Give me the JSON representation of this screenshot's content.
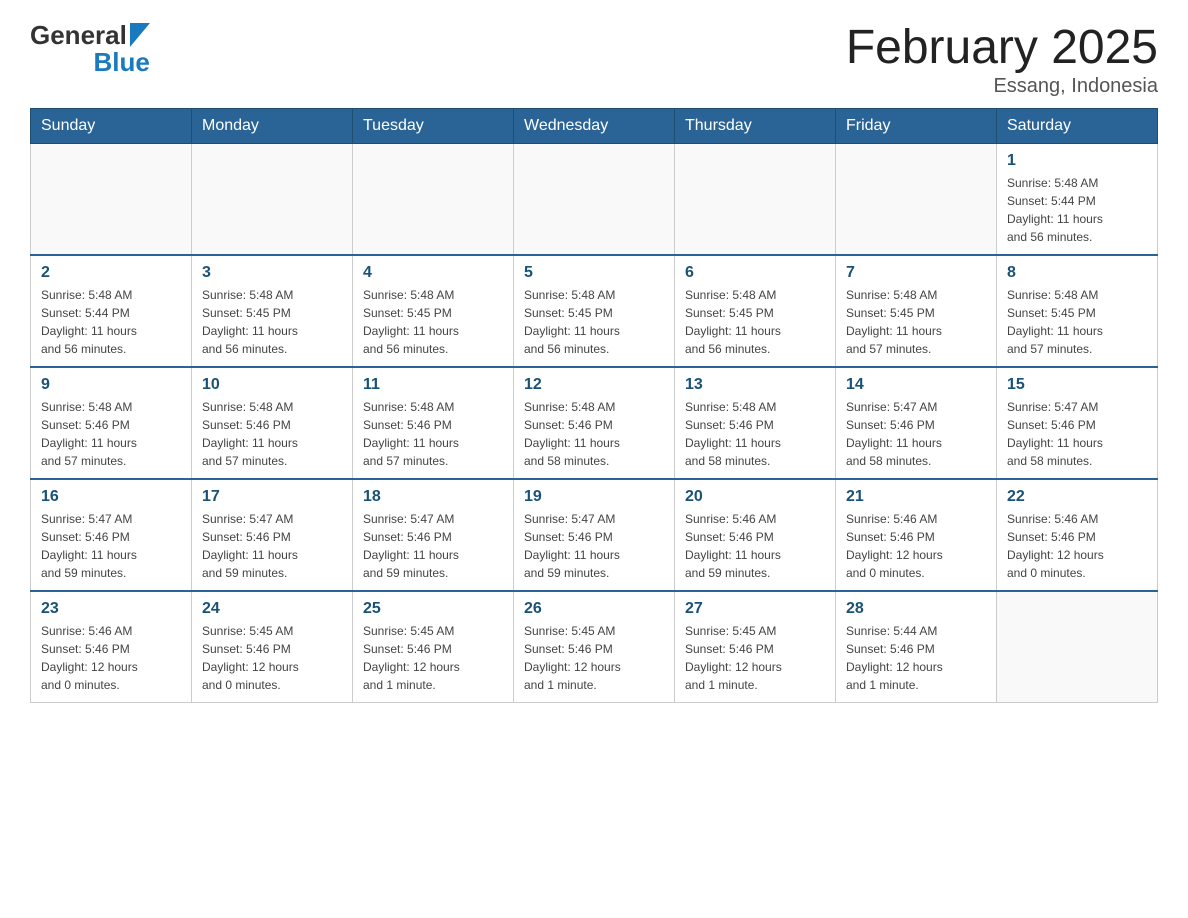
{
  "logo": {
    "general": "General",
    "blue": "Blue",
    "arrow": "▲"
  },
  "title": "February 2025",
  "subtitle": "Essang, Indonesia",
  "weekdays": [
    "Sunday",
    "Monday",
    "Tuesday",
    "Wednesday",
    "Thursday",
    "Friday",
    "Saturday"
  ],
  "weeks": [
    [
      {
        "day": "",
        "info": ""
      },
      {
        "day": "",
        "info": ""
      },
      {
        "day": "",
        "info": ""
      },
      {
        "day": "",
        "info": ""
      },
      {
        "day": "",
        "info": ""
      },
      {
        "day": "",
        "info": ""
      },
      {
        "day": "1",
        "info": "Sunrise: 5:48 AM\nSunset: 5:44 PM\nDaylight: 11 hours\nand 56 minutes."
      }
    ],
    [
      {
        "day": "2",
        "info": "Sunrise: 5:48 AM\nSunset: 5:44 PM\nDaylight: 11 hours\nand 56 minutes."
      },
      {
        "day": "3",
        "info": "Sunrise: 5:48 AM\nSunset: 5:45 PM\nDaylight: 11 hours\nand 56 minutes."
      },
      {
        "day": "4",
        "info": "Sunrise: 5:48 AM\nSunset: 5:45 PM\nDaylight: 11 hours\nand 56 minutes."
      },
      {
        "day": "5",
        "info": "Sunrise: 5:48 AM\nSunset: 5:45 PM\nDaylight: 11 hours\nand 56 minutes."
      },
      {
        "day": "6",
        "info": "Sunrise: 5:48 AM\nSunset: 5:45 PM\nDaylight: 11 hours\nand 56 minutes."
      },
      {
        "day": "7",
        "info": "Sunrise: 5:48 AM\nSunset: 5:45 PM\nDaylight: 11 hours\nand 57 minutes."
      },
      {
        "day": "8",
        "info": "Sunrise: 5:48 AM\nSunset: 5:45 PM\nDaylight: 11 hours\nand 57 minutes."
      }
    ],
    [
      {
        "day": "9",
        "info": "Sunrise: 5:48 AM\nSunset: 5:46 PM\nDaylight: 11 hours\nand 57 minutes."
      },
      {
        "day": "10",
        "info": "Sunrise: 5:48 AM\nSunset: 5:46 PM\nDaylight: 11 hours\nand 57 minutes."
      },
      {
        "day": "11",
        "info": "Sunrise: 5:48 AM\nSunset: 5:46 PM\nDaylight: 11 hours\nand 57 minutes."
      },
      {
        "day": "12",
        "info": "Sunrise: 5:48 AM\nSunset: 5:46 PM\nDaylight: 11 hours\nand 58 minutes."
      },
      {
        "day": "13",
        "info": "Sunrise: 5:48 AM\nSunset: 5:46 PM\nDaylight: 11 hours\nand 58 minutes."
      },
      {
        "day": "14",
        "info": "Sunrise: 5:47 AM\nSunset: 5:46 PM\nDaylight: 11 hours\nand 58 minutes."
      },
      {
        "day": "15",
        "info": "Sunrise: 5:47 AM\nSunset: 5:46 PM\nDaylight: 11 hours\nand 58 minutes."
      }
    ],
    [
      {
        "day": "16",
        "info": "Sunrise: 5:47 AM\nSunset: 5:46 PM\nDaylight: 11 hours\nand 59 minutes."
      },
      {
        "day": "17",
        "info": "Sunrise: 5:47 AM\nSunset: 5:46 PM\nDaylight: 11 hours\nand 59 minutes."
      },
      {
        "day": "18",
        "info": "Sunrise: 5:47 AM\nSunset: 5:46 PM\nDaylight: 11 hours\nand 59 minutes."
      },
      {
        "day": "19",
        "info": "Sunrise: 5:47 AM\nSunset: 5:46 PM\nDaylight: 11 hours\nand 59 minutes."
      },
      {
        "day": "20",
        "info": "Sunrise: 5:46 AM\nSunset: 5:46 PM\nDaylight: 11 hours\nand 59 minutes."
      },
      {
        "day": "21",
        "info": "Sunrise: 5:46 AM\nSunset: 5:46 PM\nDaylight: 12 hours\nand 0 minutes."
      },
      {
        "day": "22",
        "info": "Sunrise: 5:46 AM\nSunset: 5:46 PM\nDaylight: 12 hours\nand 0 minutes."
      }
    ],
    [
      {
        "day": "23",
        "info": "Sunrise: 5:46 AM\nSunset: 5:46 PM\nDaylight: 12 hours\nand 0 minutes."
      },
      {
        "day": "24",
        "info": "Sunrise: 5:45 AM\nSunset: 5:46 PM\nDaylight: 12 hours\nand 0 minutes."
      },
      {
        "day": "25",
        "info": "Sunrise: 5:45 AM\nSunset: 5:46 PM\nDaylight: 12 hours\nand 1 minute."
      },
      {
        "day": "26",
        "info": "Sunrise: 5:45 AM\nSunset: 5:46 PM\nDaylight: 12 hours\nand 1 minute."
      },
      {
        "day": "27",
        "info": "Sunrise: 5:45 AM\nSunset: 5:46 PM\nDaylight: 12 hours\nand 1 minute."
      },
      {
        "day": "28",
        "info": "Sunrise: 5:44 AM\nSunset: 5:46 PM\nDaylight: 12 hours\nand 1 minute."
      },
      {
        "day": "",
        "info": ""
      }
    ]
  ]
}
